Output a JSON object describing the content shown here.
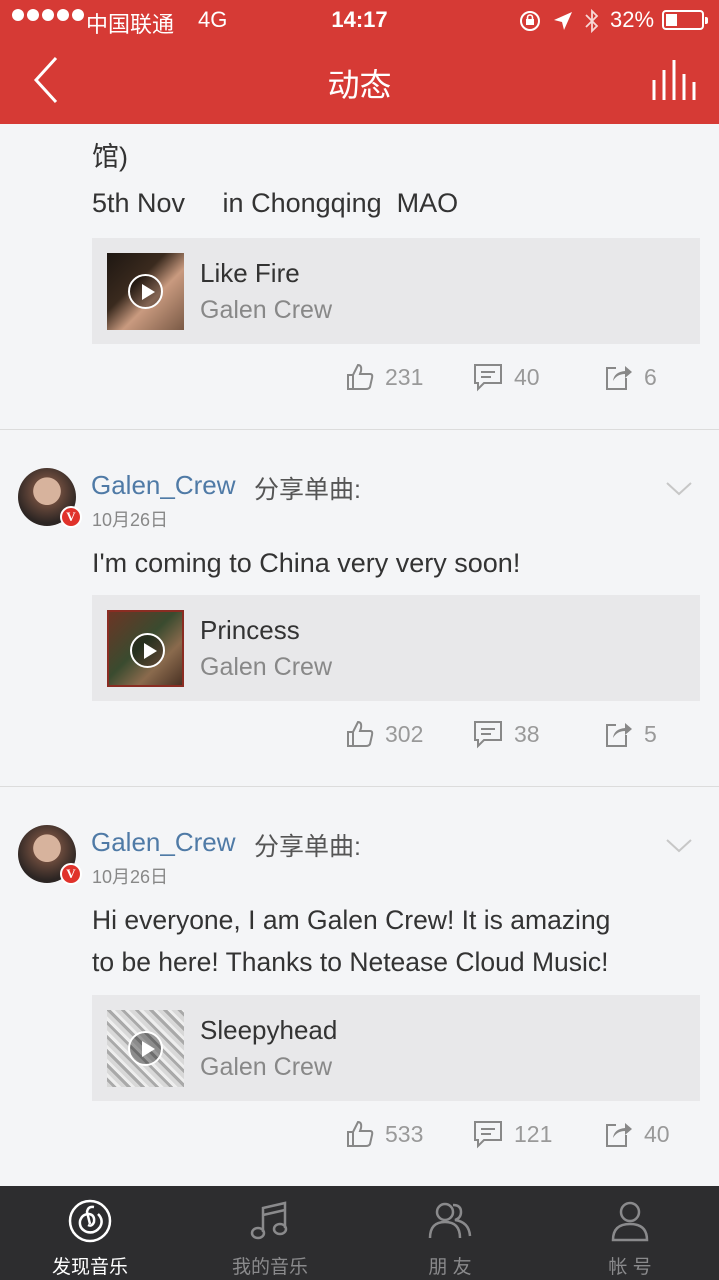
{
  "status_bar": {
    "carrier": "中国联通",
    "network": "4G",
    "time": "14:17",
    "battery_percent": "32%",
    "battery_level": 0.32
  },
  "nav": {
    "title": "动态"
  },
  "colors": {
    "brand_red": "#d63a35",
    "username_blue": "#4f7aa6",
    "tab_bar_bg": "#2d2d2f",
    "verified_badge": "#e0322b"
  },
  "posts": [
    {
      "text_lines": [
        "馆)",
        "5th Nov     in Chongqing  MAO"
      ],
      "song": {
        "title": "Like Fire",
        "artist": "Galen Crew"
      },
      "likes": "231",
      "comments": "40",
      "shares": "6"
    },
    {
      "username": "Galen_Crew",
      "share_label": "分享单曲:",
      "date": "10月26日",
      "verified_badge": "V",
      "text": "I'm coming to China very very soon!",
      "song": {
        "title": "Princess",
        "artist": "Galen Crew"
      },
      "likes": "302",
      "comments": "38",
      "shares": "5"
    },
    {
      "username": "Galen_Crew",
      "share_label": "分享单曲:",
      "date": "10月26日",
      "verified_badge": "V",
      "text_lines": [
        "Hi everyone, I am Galen Crew! It is amazing",
        "to be here! Thanks to Netease Cloud Music!"
      ],
      "song": {
        "title": "Sleepyhead",
        "artist": "Galen Crew"
      },
      "likes": "533",
      "comments": "121",
      "shares": "40"
    }
  ],
  "tabs": [
    {
      "label": "发现音乐",
      "icon": "netease-music-icon",
      "active": true
    },
    {
      "label": "我的音乐",
      "icon": "music-note-icon",
      "active": false
    },
    {
      "label": "朋 友",
      "icon": "friends-icon",
      "active": false
    },
    {
      "label": "帐 号",
      "icon": "account-icon",
      "active": false
    }
  ]
}
